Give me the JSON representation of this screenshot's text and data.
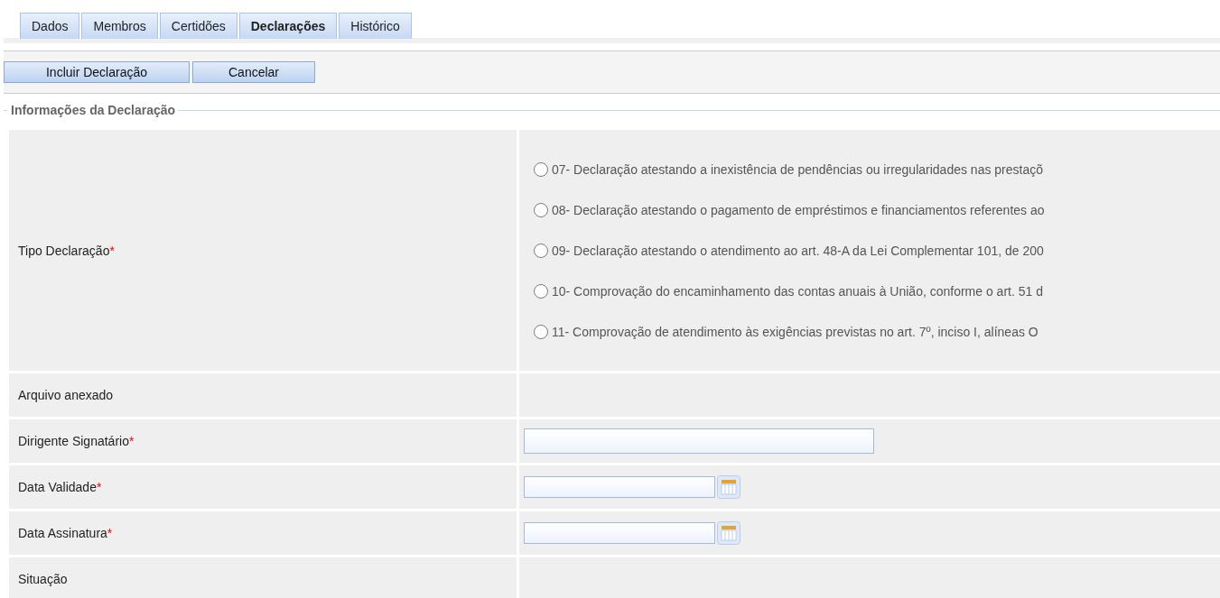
{
  "tabs": [
    {
      "label": "Dados",
      "selected": false
    },
    {
      "label": "Membros",
      "selected": false
    },
    {
      "label": "Certidões",
      "selected": false
    },
    {
      "label": "Declarações",
      "selected": true
    },
    {
      "label": "Histórico",
      "selected": false
    }
  ],
  "toolbar": {
    "buttons": [
      "Incluir Declaração",
      "Cancelar"
    ]
  },
  "section": {
    "legend": "Informações da Declaração"
  },
  "fields": [
    {
      "kind": "radio-group",
      "label": "Tipo Declaração",
      "required": "*",
      "options": [
        {
          "label": "07- Declaração atestando a inexistência de pendências ou irregularidades nas prestaçõ",
          "selected": false
        },
        {
          "label": "08- Declaração atestando o pagamento de empréstimos e financiamentos referentes ao",
          "selected": false
        },
        {
          "label": "09- Declaração atestando o atendimento ao art. 48-A da Lei Complementar 101, de 200",
          "selected": false
        },
        {
          "label": "10- Comprovação do encaminhamento das contas anuais à União, conforme o art. 51 d",
          "selected": false
        },
        {
          "label": "11- Comprovação de atendimento às exigências previstas no art. 7º, inciso I, alíneas O",
          "selected": false
        }
      ]
    },
    {
      "kind": "empty",
      "label": "Arquivo anexado"
    },
    {
      "kind": "text",
      "label": "Dirigente Signatário",
      "required": "*"
    },
    {
      "kind": "date",
      "label": "Data Validade",
      "required": "*"
    },
    {
      "kind": "date",
      "label": "Data Assinatura",
      "required": "*"
    },
    {
      "kind": "empty",
      "label": "Situação"
    }
  ]
}
